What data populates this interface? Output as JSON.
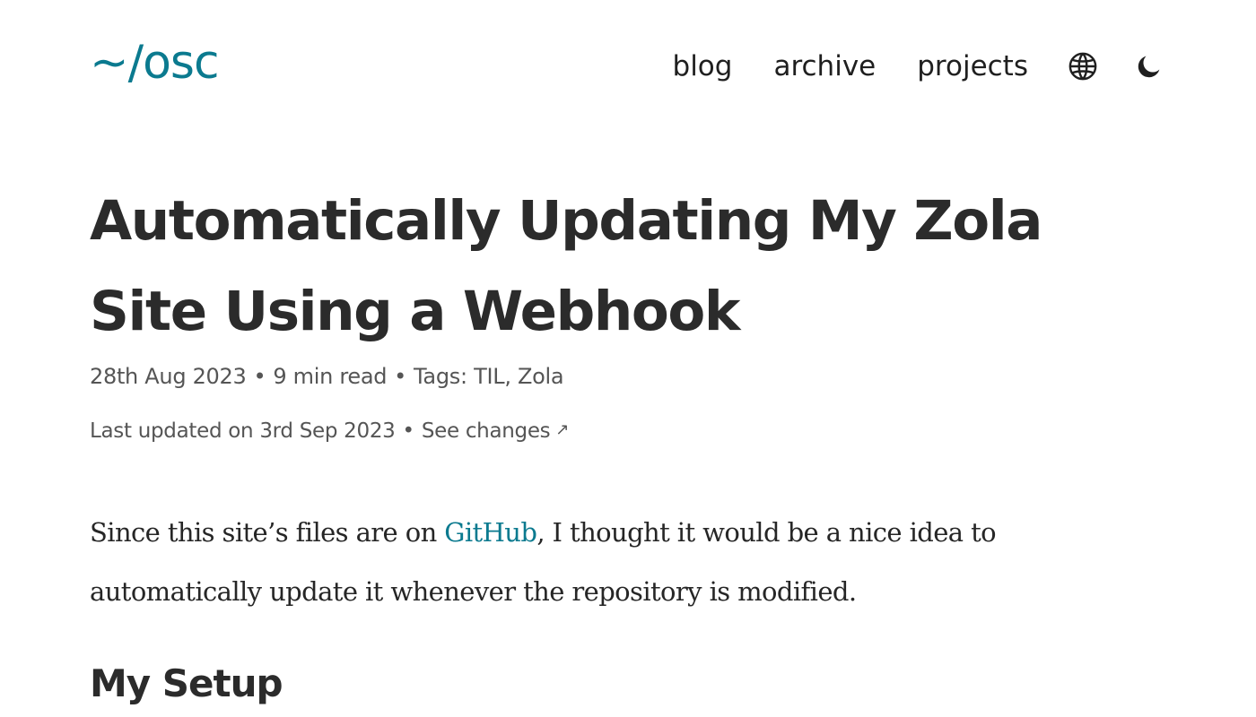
{
  "header": {
    "logo": "~/osc",
    "nav": [
      {
        "label": "blog"
      },
      {
        "label": "archive"
      },
      {
        "label": "projects"
      }
    ],
    "icons": [
      "globe-icon",
      "moon-icon"
    ]
  },
  "post": {
    "title": "Automatically Updating My Zola Site Using a Webhook",
    "date": "28th Aug 2023",
    "read_time": "9 min read",
    "tags_label": "Tags:",
    "tags": [
      "TIL",
      "Zola"
    ],
    "separator": "•",
    "updated_text": "Last updated on 3rd Sep 2023",
    "see_changes": "See changes",
    "see_changes_arrow": "↗",
    "intro_before_link": "Since this site’s files are on ",
    "intro_link": "GitHub",
    "intro_after_link": ", I thought it would be a nice idea to automatically update it whenever the repository is modified.",
    "section_heading": "My Setup"
  },
  "colors": {
    "accent": "#0b7a8f",
    "text": "#2b2b2b",
    "muted": "#555555"
  }
}
